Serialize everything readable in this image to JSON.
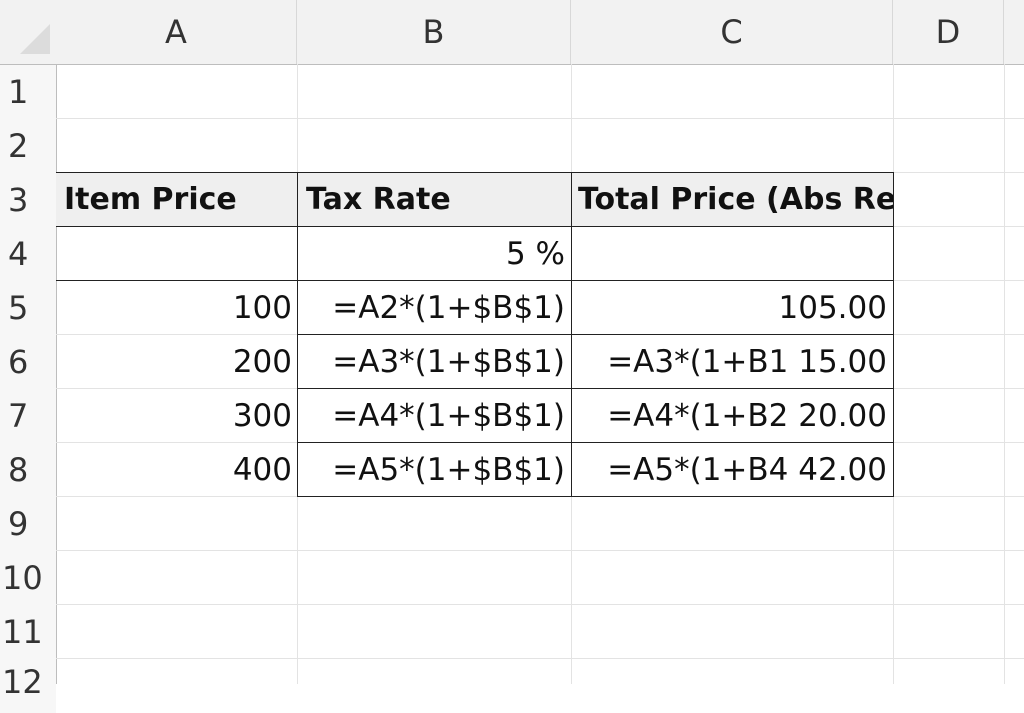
{
  "columns": [
    "A",
    "B",
    "C",
    "D"
  ],
  "rows": [
    "1",
    "2",
    "3",
    "4",
    "5",
    "6",
    "7",
    "8",
    "9",
    "10",
    "11",
    "12"
  ],
  "table": {
    "headers": [
      "Item Price",
      "Tax Rate",
      "Total Price (Abs Ref"
    ],
    "tax_rate": "5 %",
    "rows": [
      {
        "price": "100",
        "formula": "=A2*(1+$B$1)",
        "total": "105.00"
      },
      {
        "price": "200",
        "formula": "=A3*(1+$B$1)",
        "total": "=A3*(1+B1  15.00"
      },
      {
        "price": "300",
        "formula": "=A4*(1+$B$1)",
        "total": "=A4*(1+B2  20.00"
      },
      {
        "price": "400",
        "formula": "=A5*(1+$B$1)",
        "total": "=A5*(1+B4  42.00"
      }
    ]
  }
}
